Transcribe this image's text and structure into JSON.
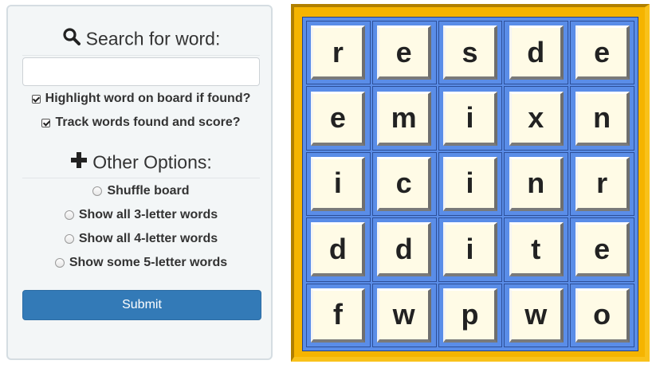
{
  "search": {
    "title": "Search for word:",
    "icon": "search-icon",
    "input_value": "",
    "input_placeholder": "",
    "highlight_label": "Highlight word on board if found?",
    "highlight_checked": true,
    "track_label": "Track words found and score?",
    "track_checked": true
  },
  "options": {
    "title": "Other Options:",
    "icon": "plus-icon",
    "items": [
      {
        "label": "Shuffle board",
        "selected": false
      },
      {
        "label": "Show all 3-letter words",
        "selected": false
      },
      {
        "label": "Show all 4-letter words",
        "selected": false
      },
      {
        "label": "Show some 5-letter words",
        "selected": false
      }
    ]
  },
  "submit_label": "Submit",
  "board": {
    "rows": [
      [
        "r",
        "e",
        "s",
        "d",
        "e"
      ],
      [
        "e",
        "m",
        "i",
        "x",
        "n"
      ],
      [
        "i",
        "c",
        "i",
        "n",
        "r"
      ],
      [
        "d",
        "d",
        "i",
        "t",
        "e"
      ],
      [
        "f",
        "w",
        "p",
        "w",
        "o"
      ]
    ],
    "colors": {
      "frame": "#f5b400",
      "grid": "#5a8de8",
      "tile": "#fffbe6"
    }
  }
}
